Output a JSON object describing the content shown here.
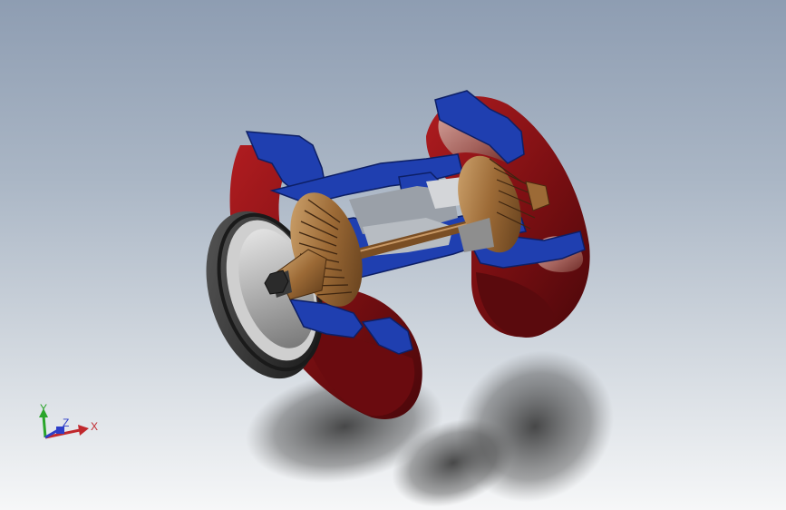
{
  "viewport": {
    "background_top": "#8e9db2",
    "background_bottom": "#f6f7f8"
  },
  "model": {
    "section_color": "#1f3fb0",
    "casing_color": "#7a0f12",
    "rotor_color": "#8a5a2b"
  },
  "triad": {
    "x_label": "X",
    "y_label": "Y",
    "z_label": "Z",
    "x_color": "#c0282d",
    "y_color": "#2aa52a",
    "z_color": "#2d3ec8"
  }
}
